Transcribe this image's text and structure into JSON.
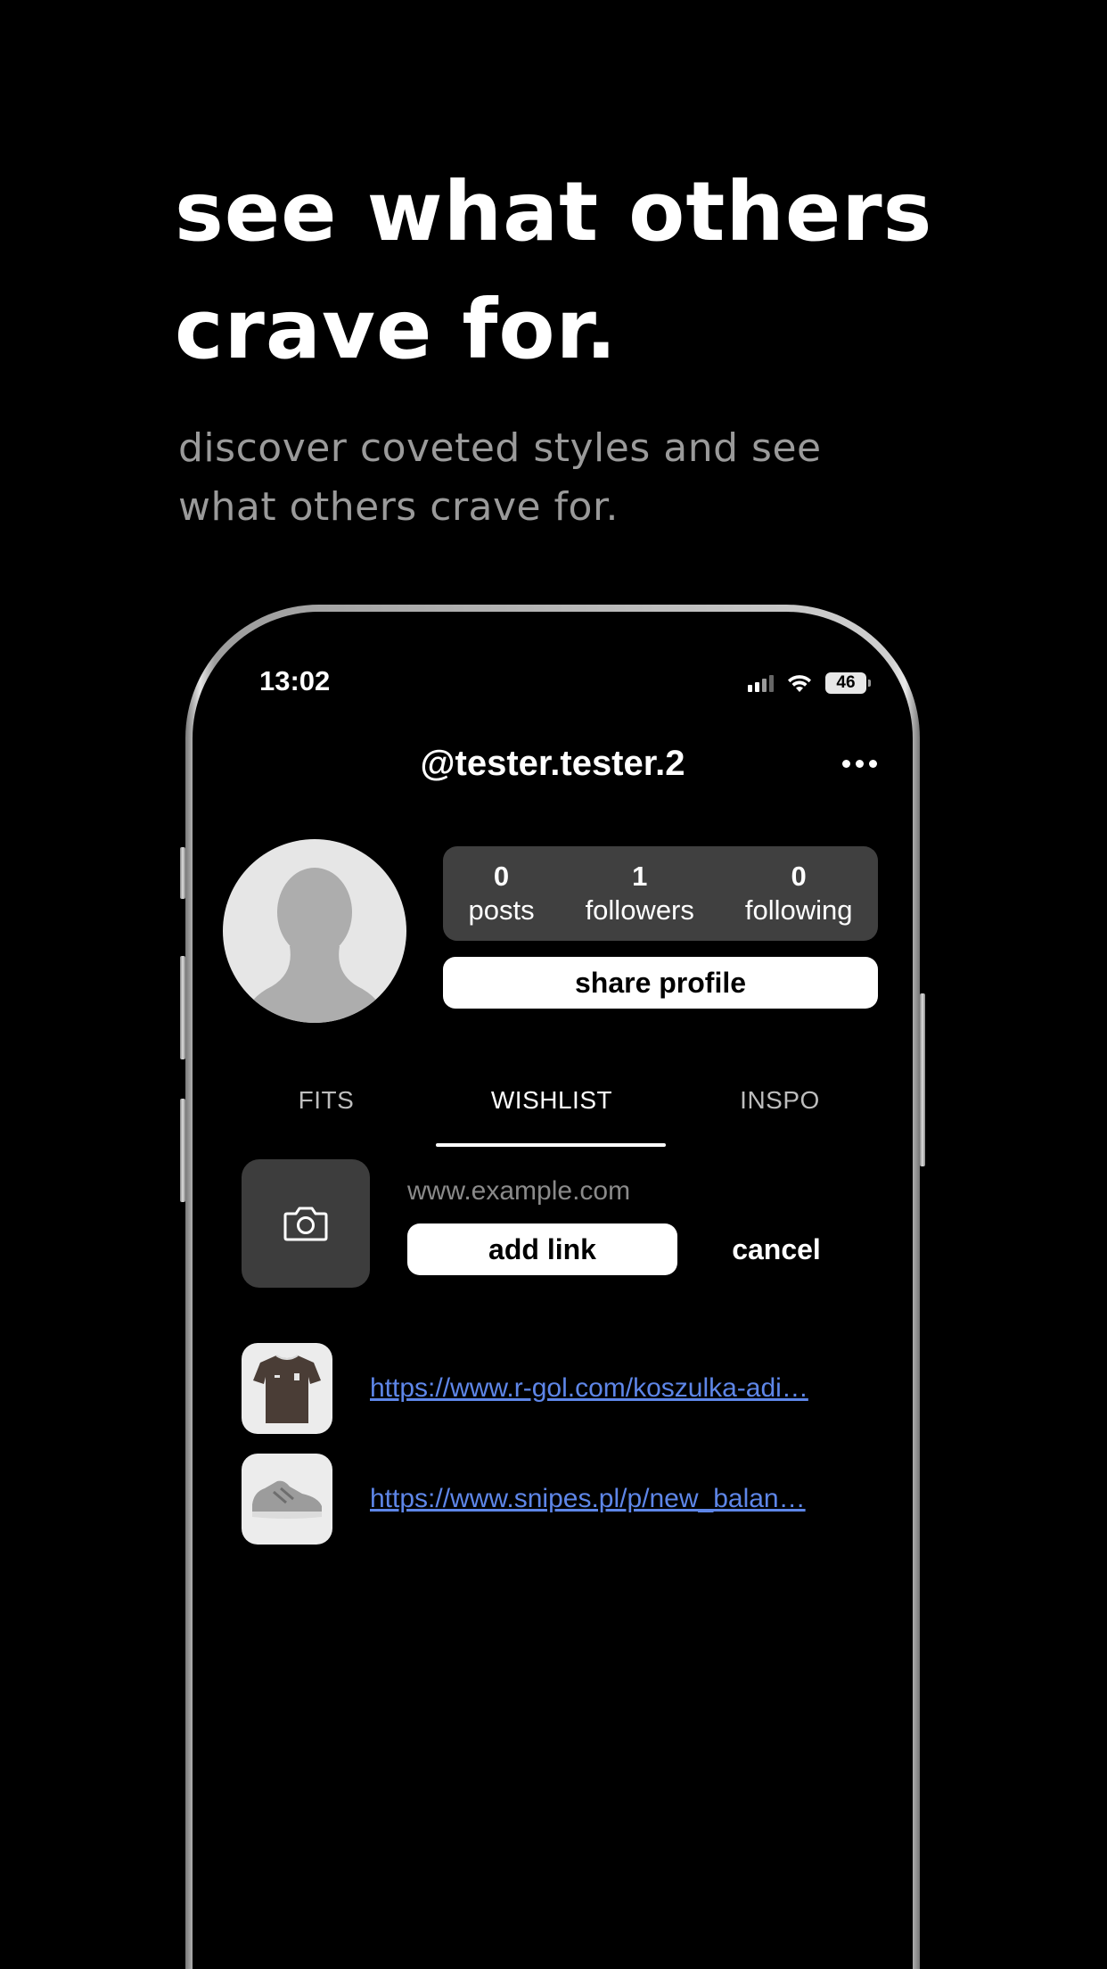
{
  "promo": {
    "headline_line1": "see what others",
    "headline_line2": "crave for.",
    "subhead_line1": "discover coveted styles and see",
    "subhead_line2": "what others crave for."
  },
  "status_bar": {
    "time": "13:02",
    "battery": "46"
  },
  "profile": {
    "handle": "@tester.tester.2",
    "stats": [
      {
        "value": "0",
        "label": "posts"
      },
      {
        "value": "1",
        "label": "followers"
      },
      {
        "value": "0",
        "label": "following"
      }
    ],
    "share_label": "share profile"
  },
  "tabs": [
    {
      "label": "FITS",
      "active": false
    },
    {
      "label": "WISHLIST",
      "active": true
    },
    {
      "label": "INSPO",
      "active": false
    }
  ],
  "add_link_form": {
    "url_placeholder": "www.example.com",
    "add_label": "add link",
    "cancel_label": "cancel"
  },
  "wishlist": [
    {
      "url": "https://www.r-gol.com/koszulka-adi…",
      "thumb_icon": "jersey-thumbnail"
    },
    {
      "url": "https://www.snipes.pl/p/new_balan…",
      "thumb_icon": "sneaker-thumbnail"
    }
  ],
  "colors": {
    "background": "#000000",
    "stats_bg": "#404040",
    "link": "#5e86e8",
    "subhead": "#9a9a9a"
  }
}
